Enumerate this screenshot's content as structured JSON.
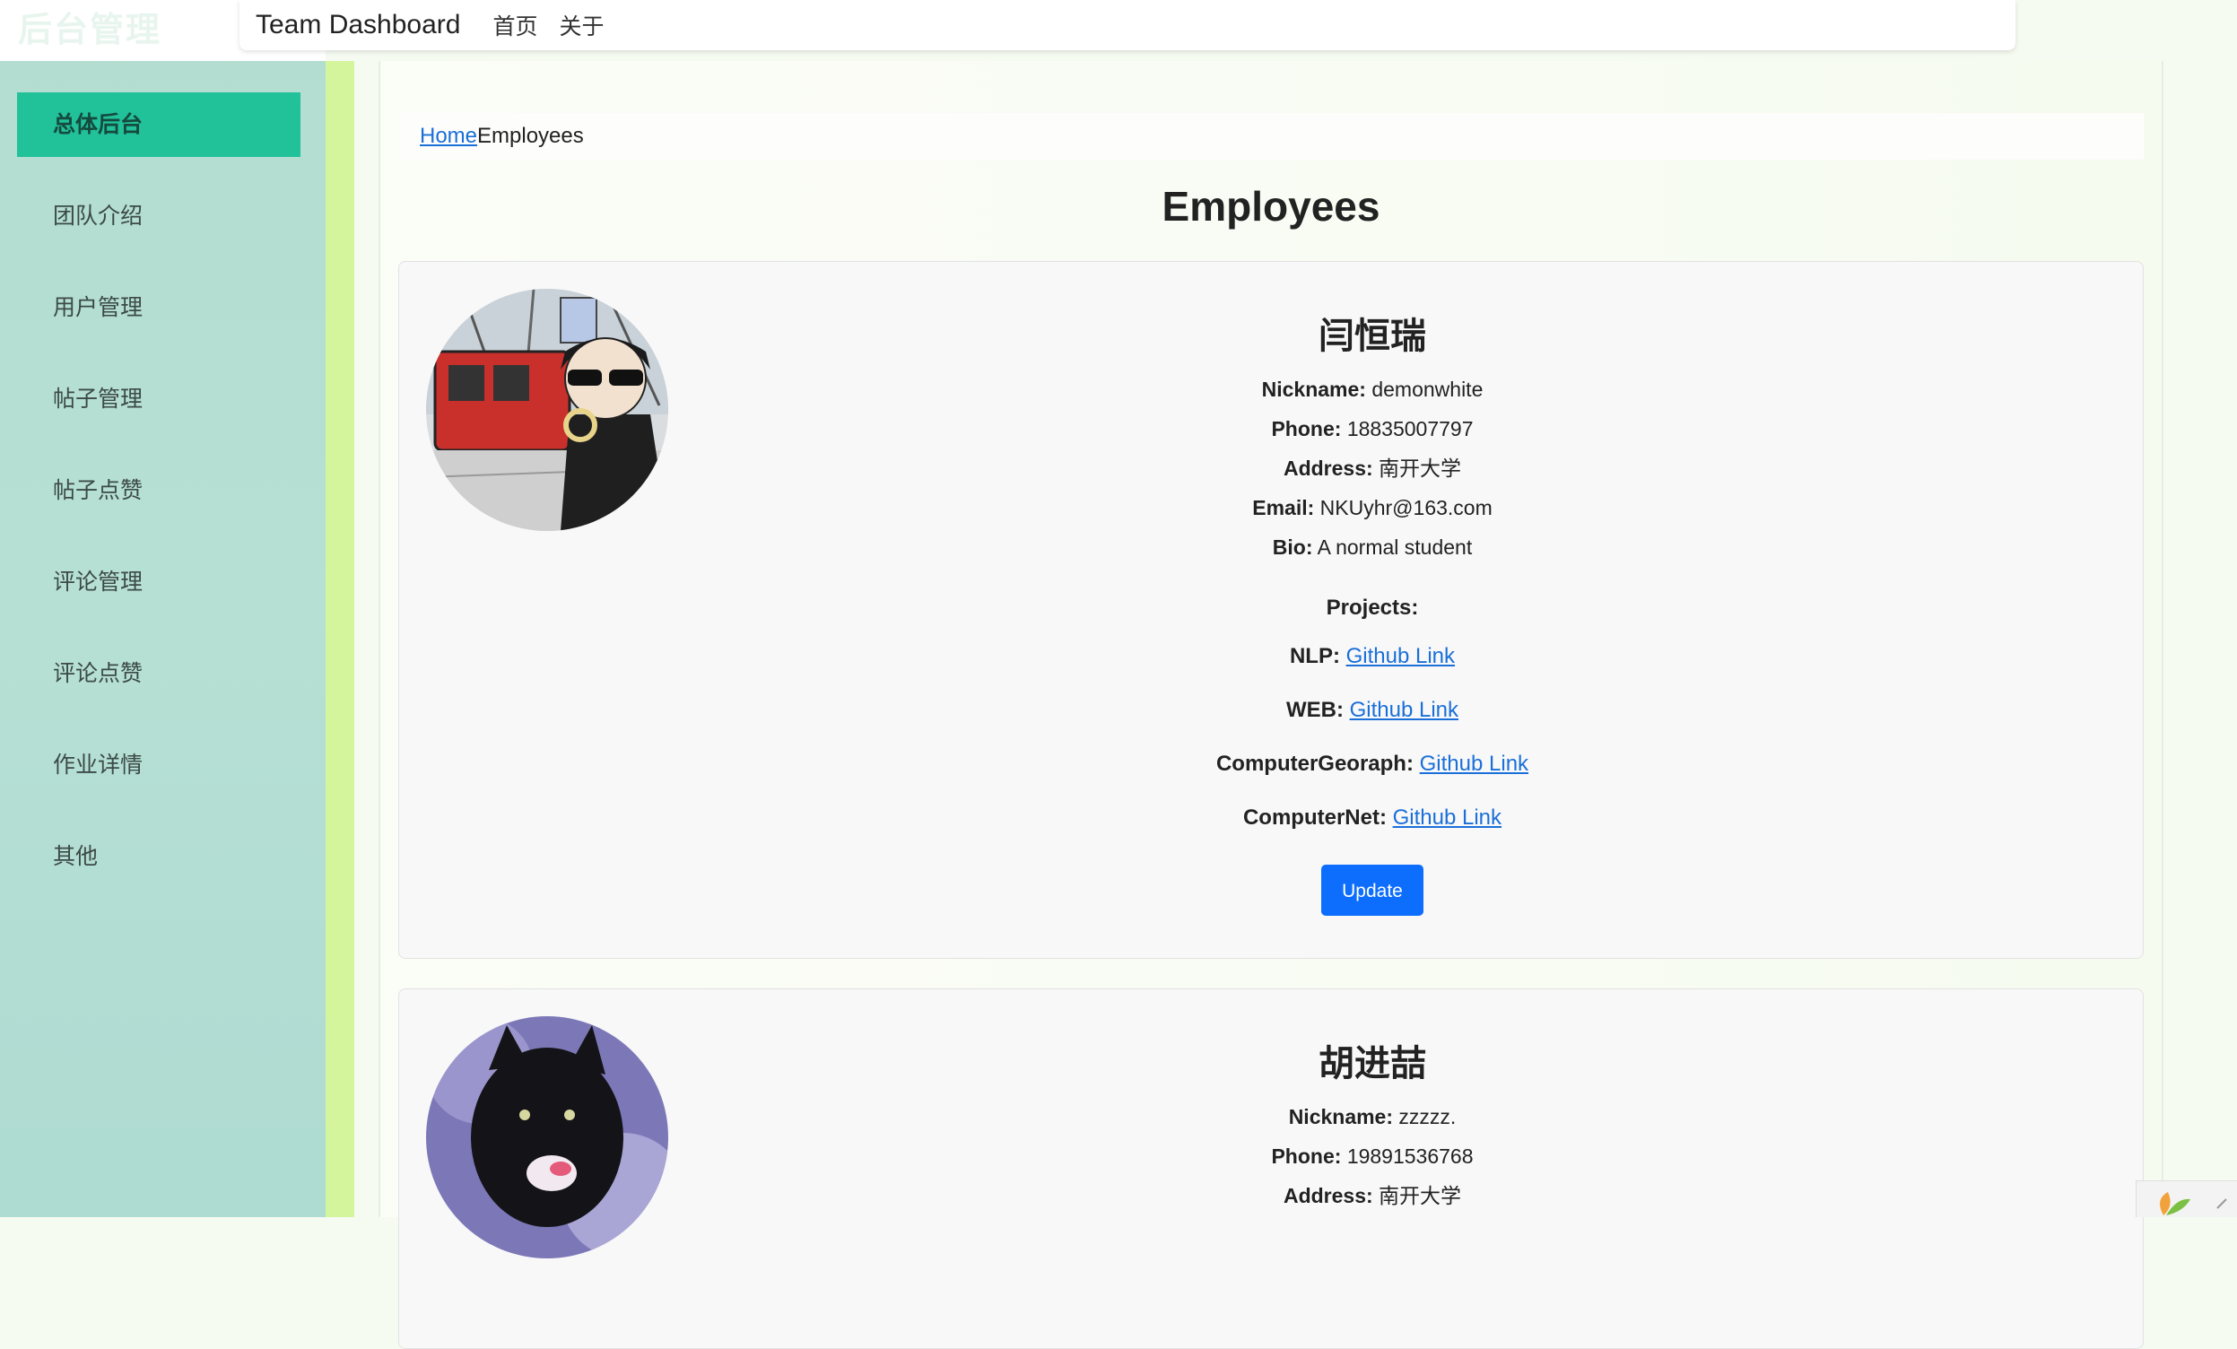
{
  "sidebar": {
    "title": "后台管理",
    "items": [
      {
        "label": "总体后台",
        "active": true
      },
      {
        "label": "团队介绍"
      },
      {
        "label": "用户管理"
      },
      {
        "label": "帖子管理"
      },
      {
        "label": "帖子点赞"
      },
      {
        "label": "评论管理"
      },
      {
        "label": "评论点赞"
      },
      {
        "label": "作业详情"
      },
      {
        "label": "其他"
      }
    ]
  },
  "topnav": {
    "brand": "Team Dashboard",
    "links": [
      "首页",
      "关于"
    ]
  },
  "breadcrumb": {
    "home": "Home",
    "current": "Employees"
  },
  "page_title": "Employees",
  "labels": {
    "nickname": "Nickname:",
    "phone": "Phone:",
    "address": "Address:",
    "email": "Email:",
    "bio": "Bio:",
    "projects": "Projects:",
    "update": "Update"
  },
  "employees": [
    {
      "name": "闫恒瑞",
      "nickname": "demonwhite",
      "phone": "18835007797",
      "address": "南开大学",
      "email": "NKUyhr@163.com",
      "bio": "A normal student",
      "projects": [
        {
          "name": "NLP:",
          "link": "Github Link"
        },
        {
          "name": "WEB:",
          "link": "Github Link"
        },
        {
          "name": "ComputerGeoraph:",
          "link": "Github Link"
        },
        {
          "name": "ComputerNet:",
          "link": "Github Link"
        }
      ]
    },
    {
      "name": "胡进喆",
      "nickname": "zzzzz.",
      "phone": "19891536768",
      "address": "南开大学"
    }
  ],
  "colors": {
    "sidebar_bg": "#b2ddd0",
    "active_item": "#21c19a",
    "stripe": "#d4f59c",
    "link": "#1a6fd8",
    "button": "#0d6efd"
  }
}
